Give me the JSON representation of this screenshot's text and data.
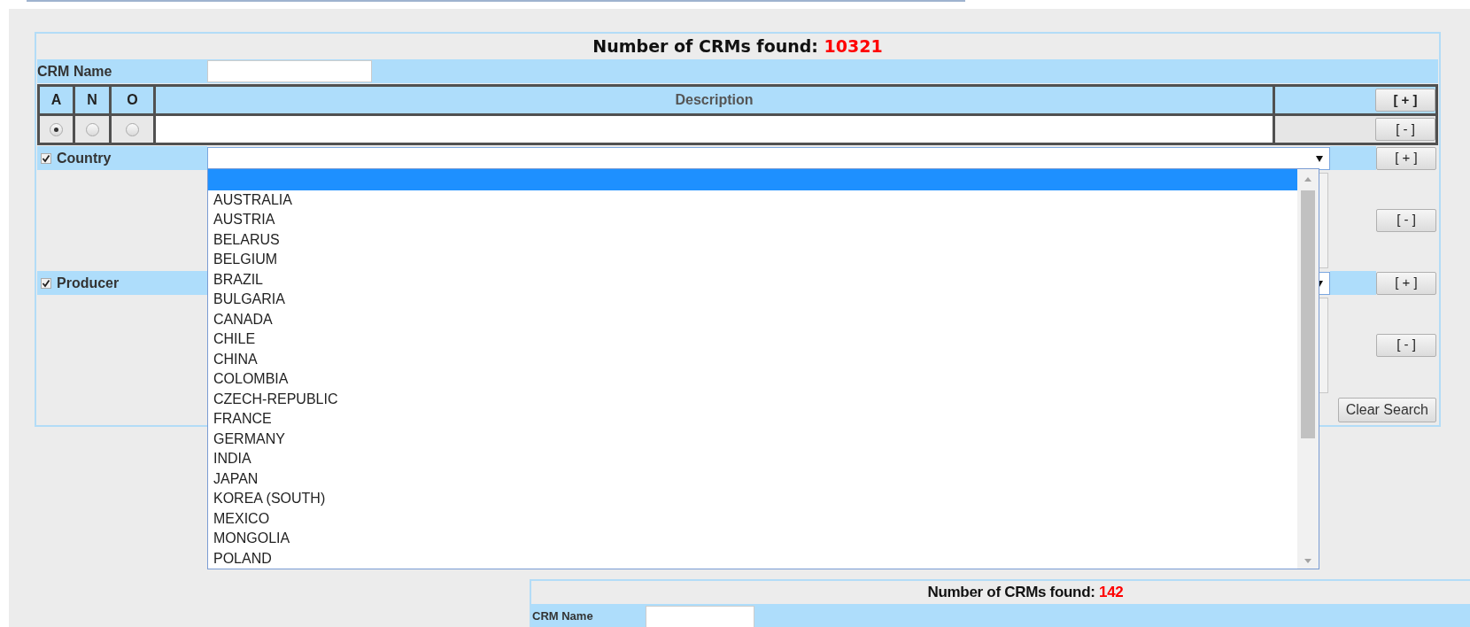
{
  "main_panel": {
    "title": {
      "label": "Number of CRMs found:",
      "count": "10321"
    },
    "crm_name": {
      "label": "CRM Name"
    },
    "description_table": {
      "columns": [
        "A",
        "N",
        "O",
        "Description"
      ],
      "add_button": "[ + ]",
      "remove_button": "[ - ]",
      "radios": [
        {
          "selected": true
        },
        {
          "selected": false
        },
        {
          "selected": false
        }
      ]
    },
    "filters": [
      {
        "label": "Country",
        "checked": true,
        "add_button": "[ + ]",
        "remove_button": "[ - ]"
      },
      {
        "label": "Producer",
        "checked": true,
        "add_button": "[ + ]",
        "remove_button": "[ - ]"
      }
    ],
    "clear_button": "Clear Search"
  },
  "country_dropdown": {
    "options": [
      {
        "selected": true
      },
      {
        "label": "AUSTRALIA",
        "selected": false
      },
      {
        "label": "AUSTRIA",
        "selected": false
      },
      {
        "label": "BELARUS",
        "selected": false
      },
      {
        "label": "BELGIUM",
        "selected": false
      },
      {
        "label": "BRAZIL",
        "selected": false
      },
      {
        "label": "BULGARIA",
        "selected": false
      },
      {
        "label": "CANADA",
        "selected": false
      },
      {
        "label": "CHILE",
        "selected": false
      },
      {
        "label": "CHINA",
        "selected": false
      },
      {
        "label": "COLOMBIA",
        "selected": false
      },
      {
        "label": "CZECH-REPUBLIC",
        "selected": false
      },
      {
        "label": "FRANCE",
        "selected": false
      },
      {
        "label": "GERMANY",
        "selected": false
      },
      {
        "label": "INDIA",
        "selected": false
      },
      {
        "label": "JAPAN",
        "selected": false
      },
      {
        "label": "KOREA (SOUTH)",
        "selected": false
      },
      {
        "label": "MEXICO",
        "selected": false
      },
      {
        "label": "MONGOLIA",
        "selected": false
      },
      {
        "label": "POLAND",
        "selected": false
      }
    ]
  },
  "second_panel": {
    "title": {
      "label": "Number of CRMs found:",
      "count": "142"
    },
    "crm_name": {
      "label": "CRM Name"
    }
  }
}
